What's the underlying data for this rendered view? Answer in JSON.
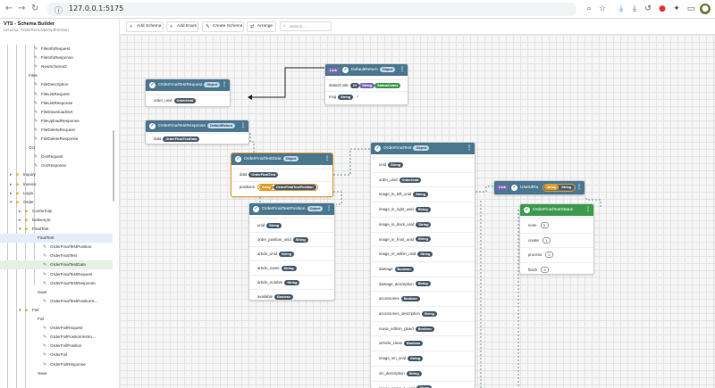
{
  "browser": {
    "url": "127.0.0.1:5175",
    "back_icon": "←",
    "forward_icon": "→",
    "reload_icon": "↻",
    "info_icon": "ⓘ"
  },
  "app": {
    "title": "VTS - Schema Builder",
    "subtitle": "Schema: OrderRemovalImplPosition"
  },
  "tree": [
    {
      "label": "FileInfoRequest",
      "indent": 2,
      "icon": "schema"
    },
    {
      "label": "FileInfoResponse",
      "indent": 2,
      "icon": "schema"
    },
    {
      "label": "NewSchema3",
      "indent": 2,
      "icon": "schema"
    },
    {
      "label": "Files",
      "indent": 1,
      "icon": "none"
    },
    {
      "label": "FileDescription",
      "indent": 2,
      "icon": "schema"
    },
    {
      "label": "FileListRequest",
      "indent": 2,
      "icon": "schema"
    },
    {
      "label": "FileListResponse",
      "indent": 2,
      "icon": "schema"
    },
    {
      "label": "FileDownloadGet",
      "indent": 2,
      "icon": "schema"
    },
    {
      "label": "FileUploadResponse",
      "indent": 2,
      "icon": "schema"
    },
    {
      "label": "FileDeleteRequest",
      "indent": 2,
      "icon": "schema"
    },
    {
      "label": "FileDeleteResponse",
      "indent": 2,
      "icon": "schema"
    },
    {
      "label": "Ocr",
      "indent": 1,
      "icon": "none"
    },
    {
      "label": "OcrRequest",
      "indent": 2,
      "icon": "schema"
    },
    {
      "label": "OcrResponse",
      "indent": 2,
      "icon": "schema"
    },
    {
      "label": "Inquiry",
      "indent": 0,
      "icon": "folder"
    },
    {
      "label": "Invoice",
      "indent": 0,
      "icon": "folder"
    },
    {
      "label": "Login",
      "indent": 0,
      "icon": "folder"
    },
    {
      "label": "Order",
      "indent": 0,
      "icon": "folder-open"
    },
    {
      "label": "Conformity",
      "indent": 1,
      "icon": "folder"
    },
    {
      "label": "DeliveryIn",
      "indent": 1,
      "icon": "folder"
    },
    {
      "label": "FinalTest",
      "indent": 1,
      "icon": "folder-open"
    },
    {
      "label": "FinalTest",
      "indent": 2,
      "icon": "none",
      "selected": true
    },
    {
      "label": "OrderFinalTestPosition",
      "indent": 3,
      "icon": "schema"
    },
    {
      "label": "OrderFinalTest",
      "indent": 3,
      "icon": "schema"
    },
    {
      "label": "OrderFinalTestData",
      "indent": 3,
      "icon": "schema",
      "active": true
    },
    {
      "label": "OrderFinalTestRequest",
      "indent": 3,
      "icon": "schema"
    },
    {
      "label": "OrderFinalTestResponse",
      "indent": 3,
      "icon": "schema"
    },
    {
      "label": "Save",
      "indent": 2,
      "icon": "none"
    },
    {
      "label": "OrderFinalTestPositionS...",
      "indent": 3,
      "icon": "schema"
    },
    {
      "label": "Foil",
      "indent": 1,
      "icon": "folder-open"
    },
    {
      "label": "Foil",
      "indent": 2,
      "icon": "none"
    },
    {
      "label": "OrderFoilRequest",
      "indent": 3,
      "icon": "schema"
    },
    {
      "label": "OrderFoilPositionInstru...",
      "indent": 3,
      "icon": "schema"
    },
    {
      "label": "OrderFoilPosition",
      "indent": 3,
      "icon": "schema"
    },
    {
      "label": "OrderFoil",
      "indent": 3,
      "icon": "schema"
    },
    {
      "label": "OrderFoilResponse",
      "indent": 3,
      "icon": "schema"
    },
    {
      "label": "Save",
      "indent": 2,
      "icon": "none"
    }
  ],
  "toolbar": {
    "add_schema": "Add Schema",
    "add_enum": "Add Enum",
    "create_schema": "Create Schema",
    "arrange": "Arrange",
    "search_placeholder": "Search..."
  },
  "nodes": {
    "request": {
      "title": "OrderFinalTestRequest",
      "badge": "Object",
      "fields": [
        {
          "name": "order_unid",
          "type": "OrderUnid"
        }
      ]
    },
    "response": {
      "title": "OrderFinalTestResponse",
      "badge": "DefaultReturn",
      "fields": [
        {
          "name": "data",
          "type": "OrderFinalTestData"
        }
      ]
    },
    "default_return": {
      "title": "DefaultReturn",
      "link": "Link",
      "badge": "Object",
      "statuscode_name": "statusCode",
      "statuscode_tags": [
        "Or",
        "String",
        "StatusCodes"
      ],
      "msg_name": "msg",
      "msg_type": "String"
    },
    "data": {
      "title": "OrderFinalTestData",
      "badge": "Object",
      "fields": [
        {
          "name": "data",
          "type": "OrderFinalTest"
        },
        {
          "name": "positions",
          "array": "Array",
          "type": "OrderFinalTestPosition"
        }
      ]
    },
    "position": {
      "title": "OrderFinalTestPosition",
      "badge": "Object",
      "fields": [
        {
          "name": "unid",
          "type": "String"
        },
        {
          "name": "order_position_unid",
          "type": "String"
        },
        {
          "name": "article_unid",
          "type": "String"
        },
        {
          "name": "article_name",
          "type": "String"
        },
        {
          "name": "article_number",
          "type": "String"
        },
        {
          "name": "available",
          "type": "Boolean"
        }
      ]
    },
    "final_test": {
      "title": "OrderFinalTest",
      "badge": "Object",
      "fields": [
        {
          "name": "unid",
          "type": "String"
        },
        {
          "name": "order_unid",
          "type": "OrderUnid"
        },
        {
          "name": "image_in_left_unid",
          "type": "String"
        },
        {
          "name": "image_in_right_unid",
          "type": "String"
        },
        {
          "name": "image_in_back_unid",
          "type": "String"
        },
        {
          "name": "image_in_front_unid",
          "type": "String"
        },
        {
          "name": "image_in_within_unid",
          "type": "String"
        },
        {
          "name": "damage",
          "type": "Boolean"
        },
        {
          "name": "damage_description",
          "type": "String"
        },
        {
          "name": "accessories",
          "type": "Boolean"
        },
        {
          "name": "accessories_description",
          "type": "String"
        },
        {
          "name": "reuse_edition_glued",
          "type": "Boolean"
        },
        {
          "name": "vehicle_clean",
          "type": "Boolean"
        },
        {
          "name": "image_vin_unid",
          "type": "String"
        },
        {
          "name": "vin_description",
          "type": "String"
        },
        {
          "name": "image_paper_1_unid",
          "type": "String"
        }
      ]
    },
    "user_id": {
      "title": "UserIdRa",
      "link": "Link",
      "array": "Array",
      "type": "String"
    },
    "status": {
      "title": "OrderFinalTestStatus",
      "fields": [
        {
          "name": "none",
          "value": "0"
        },
        {
          "name": "create",
          "value": "1"
        },
        {
          "name": "process",
          "value": "2"
        },
        {
          "name": "finish",
          "value": "3"
        }
      ]
    }
  },
  "colors": {
    "node_header": "#4a7790",
    "enum_header": "#3c9a4e",
    "highlight": "#e09a28",
    "wire_dashed": "#4a7790"
  }
}
